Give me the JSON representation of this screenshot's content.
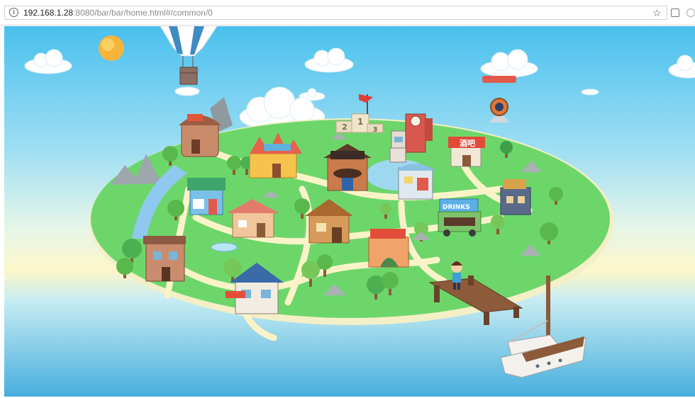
{
  "browser": {
    "info_icon_glyph": "i",
    "url_host": "192.168.1.28",
    "url_rest": ":8080/bar/bar/home.html#/common/0",
    "bookmark_star": "☆"
  },
  "map": {
    "podium": {
      "first": "1",
      "second": "2",
      "third": "3"
    },
    "buildings": [
      {
        "id": "tower-top-left",
        "sign": ""
      },
      {
        "id": "castle",
        "sign": ""
      },
      {
        "id": "mustache-house",
        "sign": ""
      },
      {
        "id": "city-hall",
        "sign": ""
      },
      {
        "id": "bar-shop",
        "sign": "酒吧"
      },
      {
        "id": "round-shop",
        "sign": ""
      },
      {
        "id": "left-shop",
        "sign": ""
      },
      {
        "id": "factory",
        "sign": ""
      },
      {
        "id": "drinks-truck",
        "sign": "DRINKS"
      },
      {
        "id": "small-house-right",
        "sign": ""
      },
      {
        "id": "pink-cottage",
        "sign": ""
      },
      {
        "id": "wooden-cabin",
        "sign": ""
      },
      {
        "id": "hall",
        "sign": ""
      },
      {
        "id": "brick-house",
        "sign": ""
      },
      {
        "id": "blue-house",
        "sign": ""
      }
    ],
    "colors": {
      "sky_top": "#4ec3ee",
      "sky_mid": "#bfe9f5",
      "horizon": "#fbf6c9",
      "sea": "#4fb3e0",
      "grass": "#6dd66b",
      "path": "#fbf3c8",
      "sun": "#f8b83a"
    }
  }
}
